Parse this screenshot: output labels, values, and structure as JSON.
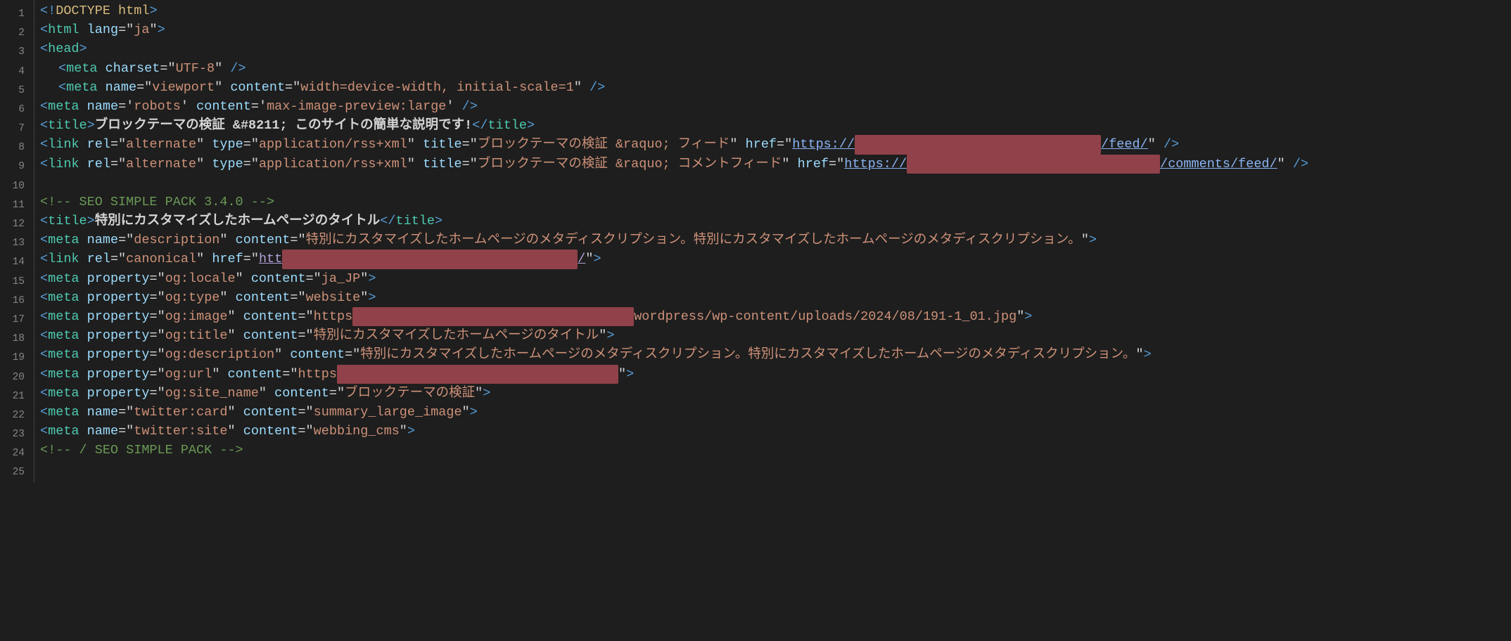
{
  "lines": [
    1,
    2,
    3,
    4,
    5,
    6,
    7,
    8,
    9,
    10,
    11,
    12,
    13,
    14,
    15,
    16,
    17,
    18,
    19,
    20,
    21,
    22,
    23,
    24,
    25
  ],
  "code": {
    "doctype": "DOCTYPE html",
    "html": {
      "tag": "html",
      "attrs": {
        "lang": "ja"
      }
    },
    "head": {
      "tag": "head"
    },
    "meta_charset": {
      "tag": "meta",
      "attrs": {
        "charset": "UTF-8"
      }
    },
    "meta_viewport": {
      "tag": "meta",
      "attrs": {
        "name": "viewport",
        "content": "width=device-width, initial-scale=1"
      }
    },
    "meta_robots": {
      "tag": "meta",
      "attrs": {
        "name": "robots",
        "content": "max-image-preview:large"
      }
    },
    "title1": {
      "tag": "title",
      "text": "ブロックテーマの検証 &#8211; このサイトの簡単な説明です!"
    },
    "link_alt1": {
      "tag": "link",
      "attrs": {
        "rel": "alternate",
        "type": "application/rss+xml",
        "title": "ブロックテーマの検証 &raquo; フィード",
        "href_pre": "https://",
        "href_post": "/feed/"
      }
    },
    "link_alt2": {
      "tag": "link",
      "attrs": {
        "rel": "alternate",
        "type": "application/rss+xml",
        "title": "ブロックテーマの検証 &raquo; コメントフィード",
        "href_pre": "https://",
        "href_post": "/comments/feed/"
      }
    },
    "comment_open": "<!-- SEO SIMPLE PACK 3.4.0 -->",
    "title2": {
      "tag": "title",
      "text": "特別にカスタマイズしたホームページのタイトル"
    },
    "meta_desc": {
      "tag": "meta",
      "attrs": {
        "name": "description",
        "content": "特別にカスタマイズしたホームページのメタディスクリプション。特別にカスタマイズしたホームページのメタディスクリプション。"
      }
    },
    "link_canonical": {
      "tag": "link",
      "attrs": {
        "rel": "canonical",
        "href_pre": "htt",
        "href_post": "/"
      }
    },
    "meta_og_locale": {
      "tag": "meta",
      "attrs": {
        "property": "og:locale",
        "content": "ja_JP"
      }
    },
    "meta_og_type": {
      "tag": "meta",
      "attrs": {
        "property": "og:type",
        "content": "website"
      }
    },
    "meta_og_image": {
      "tag": "meta",
      "attrs": {
        "property": "og:image",
        "content_pre": "https",
        "content_post": "wordpress/wp-content/uploads/2024/08/191-1_01.jpg"
      }
    },
    "meta_og_title": {
      "tag": "meta",
      "attrs": {
        "property": "og:title",
        "content": "特別にカスタマイズしたホームページのタイトル"
      }
    },
    "meta_og_desc": {
      "tag": "meta",
      "attrs": {
        "property": "og:description",
        "content": "特別にカスタマイズしたホームページのメタディスクリプション。特別にカスタマイズしたホームページのメタディスクリプション。"
      }
    },
    "meta_og_url": {
      "tag": "meta",
      "attrs": {
        "property": "og:url",
        "content_pre": "https",
        "content_post": ""
      }
    },
    "meta_og_sitename": {
      "tag": "meta",
      "attrs": {
        "property": "og:site_name",
        "content": "ブロックテーマの検証"
      }
    },
    "meta_tw_card": {
      "tag": "meta",
      "attrs": {
        "name": "twitter:card",
        "content": "summary_large_image"
      }
    },
    "meta_tw_site": {
      "tag": "meta",
      "attrs": {
        "name": "twitter:site",
        "content": "webbing_cms"
      }
    },
    "comment_close": "<!-- / SEO SIMPLE PACK -->"
  }
}
